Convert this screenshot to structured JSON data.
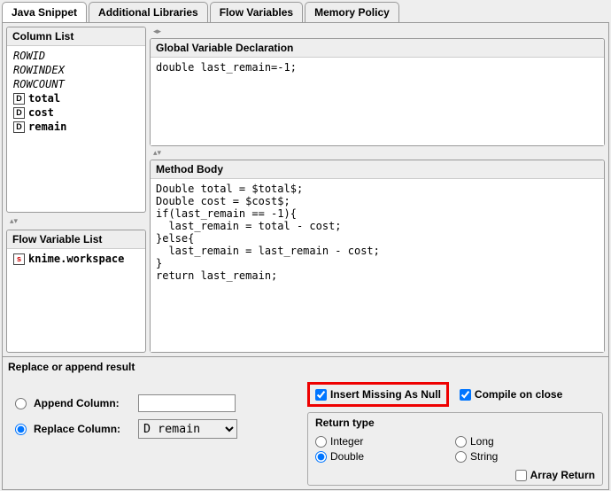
{
  "tabs": [
    "Java Snippet",
    "Additional Libraries",
    "Flow Variables",
    "Memory Policy"
  ],
  "columnList": {
    "title": "Column List",
    "builtin": [
      "ROWID",
      "ROWINDEX",
      "ROWCOUNT"
    ],
    "cols": [
      {
        "type": "D",
        "name": "total"
      },
      {
        "type": "D",
        "name": "cost"
      },
      {
        "type": "D",
        "name": "remain"
      }
    ]
  },
  "flowList": {
    "title": "Flow Variable List",
    "items": [
      {
        "type": "s",
        "name": "knime.workspace"
      }
    ]
  },
  "gvd": {
    "title": "Global Variable Declaration",
    "code": "double last_remain=-1;"
  },
  "mb": {
    "title": "Method Body",
    "code": "Double total = $total$;\nDouble cost = $cost$;\nif(last_remain == -1){\n  last_remain = total - cost;\n}else{\n  last_remain = last_remain - cost;\n}\nreturn last_remain;"
  },
  "result": {
    "title": "Replace or append result",
    "append": "Append Column:",
    "replace": "Replace Column:",
    "selectedCol": "D remain"
  },
  "opts": {
    "insertMissing": "Insert Missing As Null",
    "compileOnClose": "Compile on close",
    "returnTitle": "Return type",
    "types": {
      "integer": "Integer",
      "long": "Long",
      "double": "Double",
      "string": "String"
    },
    "arrayReturn": "Array Return"
  }
}
